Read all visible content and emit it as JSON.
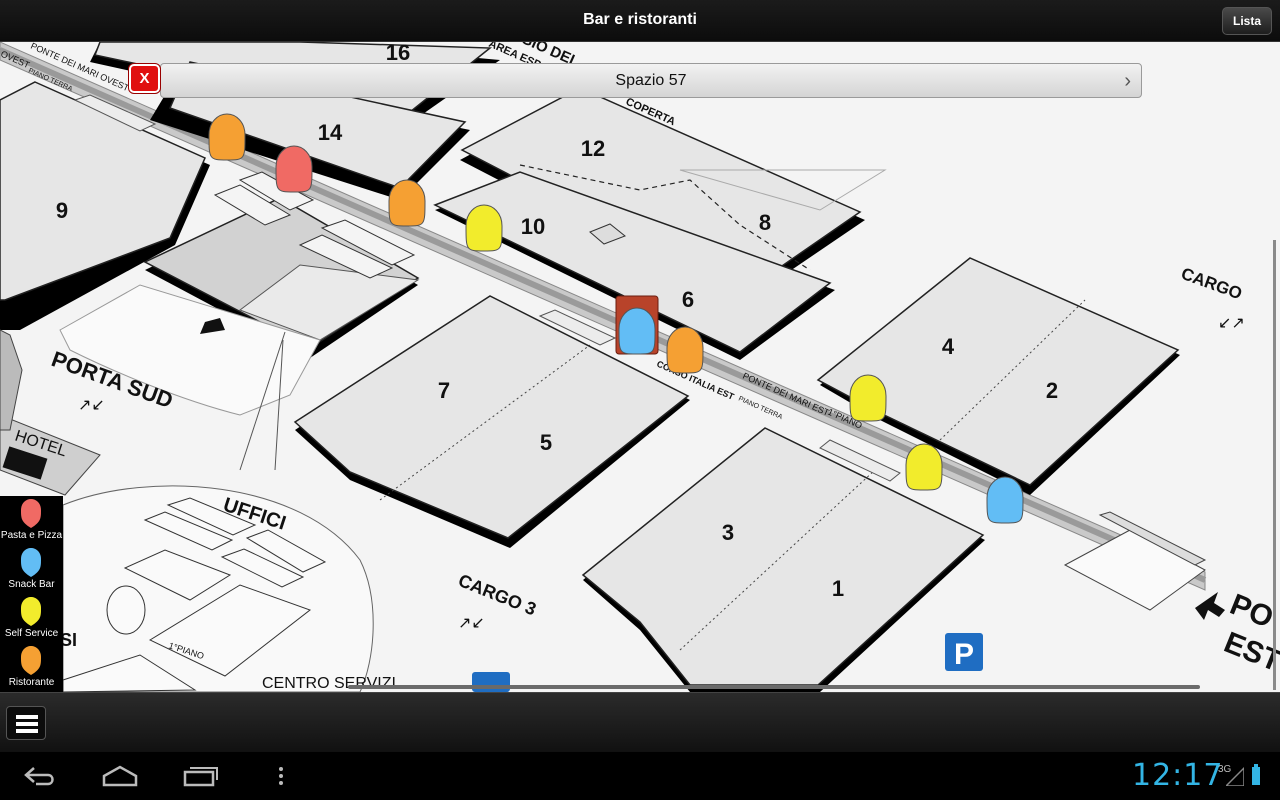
{
  "header": {
    "title": "Bar e ristoranti",
    "list_button": "Lista"
  },
  "callout": {
    "close_label": "X",
    "title": "Spazio 57",
    "chevron": "›"
  },
  "map": {
    "pavilions": [
      "16",
      "14",
      "9",
      "12",
      "8",
      "10",
      "6",
      "7",
      "5",
      "4",
      "2",
      "3",
      "1"
    ],
    "labels": {
      "porta_sud": "PORTA SUD",
      "cargo": "CARGO",
      "cargo3": "CARGO 3",
      "uffici": "UFFICI",
      "centro_servizi": "CENTRO SERVIZI",
      "hotel": "HOTEL",
      "piano1": "1°PIANO",
      "corso_italia": "CORSO ITALIA EST",
      "piano_terra": "PIANO TERRA",
      "ponte_mari_est": "PONTE DEI MARI EST",
      "ponte_piano": "1°PIANO",
      "ponte_ovest": "PONTE DEI MARI OVEST",
      "ovest": "OVEST",
      "ovest_piano": "PIANO TERRA",
      "area_espo": "AREA ESPO",
      "coperta": "COPERTA",
      "gio_del": "GIO DEL",
      "porta_est_1": "PO",
      "porta_est_2": "EST",
      "si": "SI",
      "parking": "P"
    }
  },
  "legend": {
    "items": [
      {
        "label": "Pasta e Pizza",
        "color": "#f06a64"
      },
      {
        "label": "Snack Bar",
        "color": "#62bdf5"
      },
      {
        "label": "Self Service",
        "color": "#f2ec2c"
      },
      {
        "label": "Ristorante",
        "color": "#f5a033"
      }
    ]
  },
  "status": {
    "time": "12:17",
    "network": "3G"
  },
  "colors": {
    "accent": "#33b5e5",
    "close": "#e01010",
    "parking": "#1f6dc2"
  }
}
